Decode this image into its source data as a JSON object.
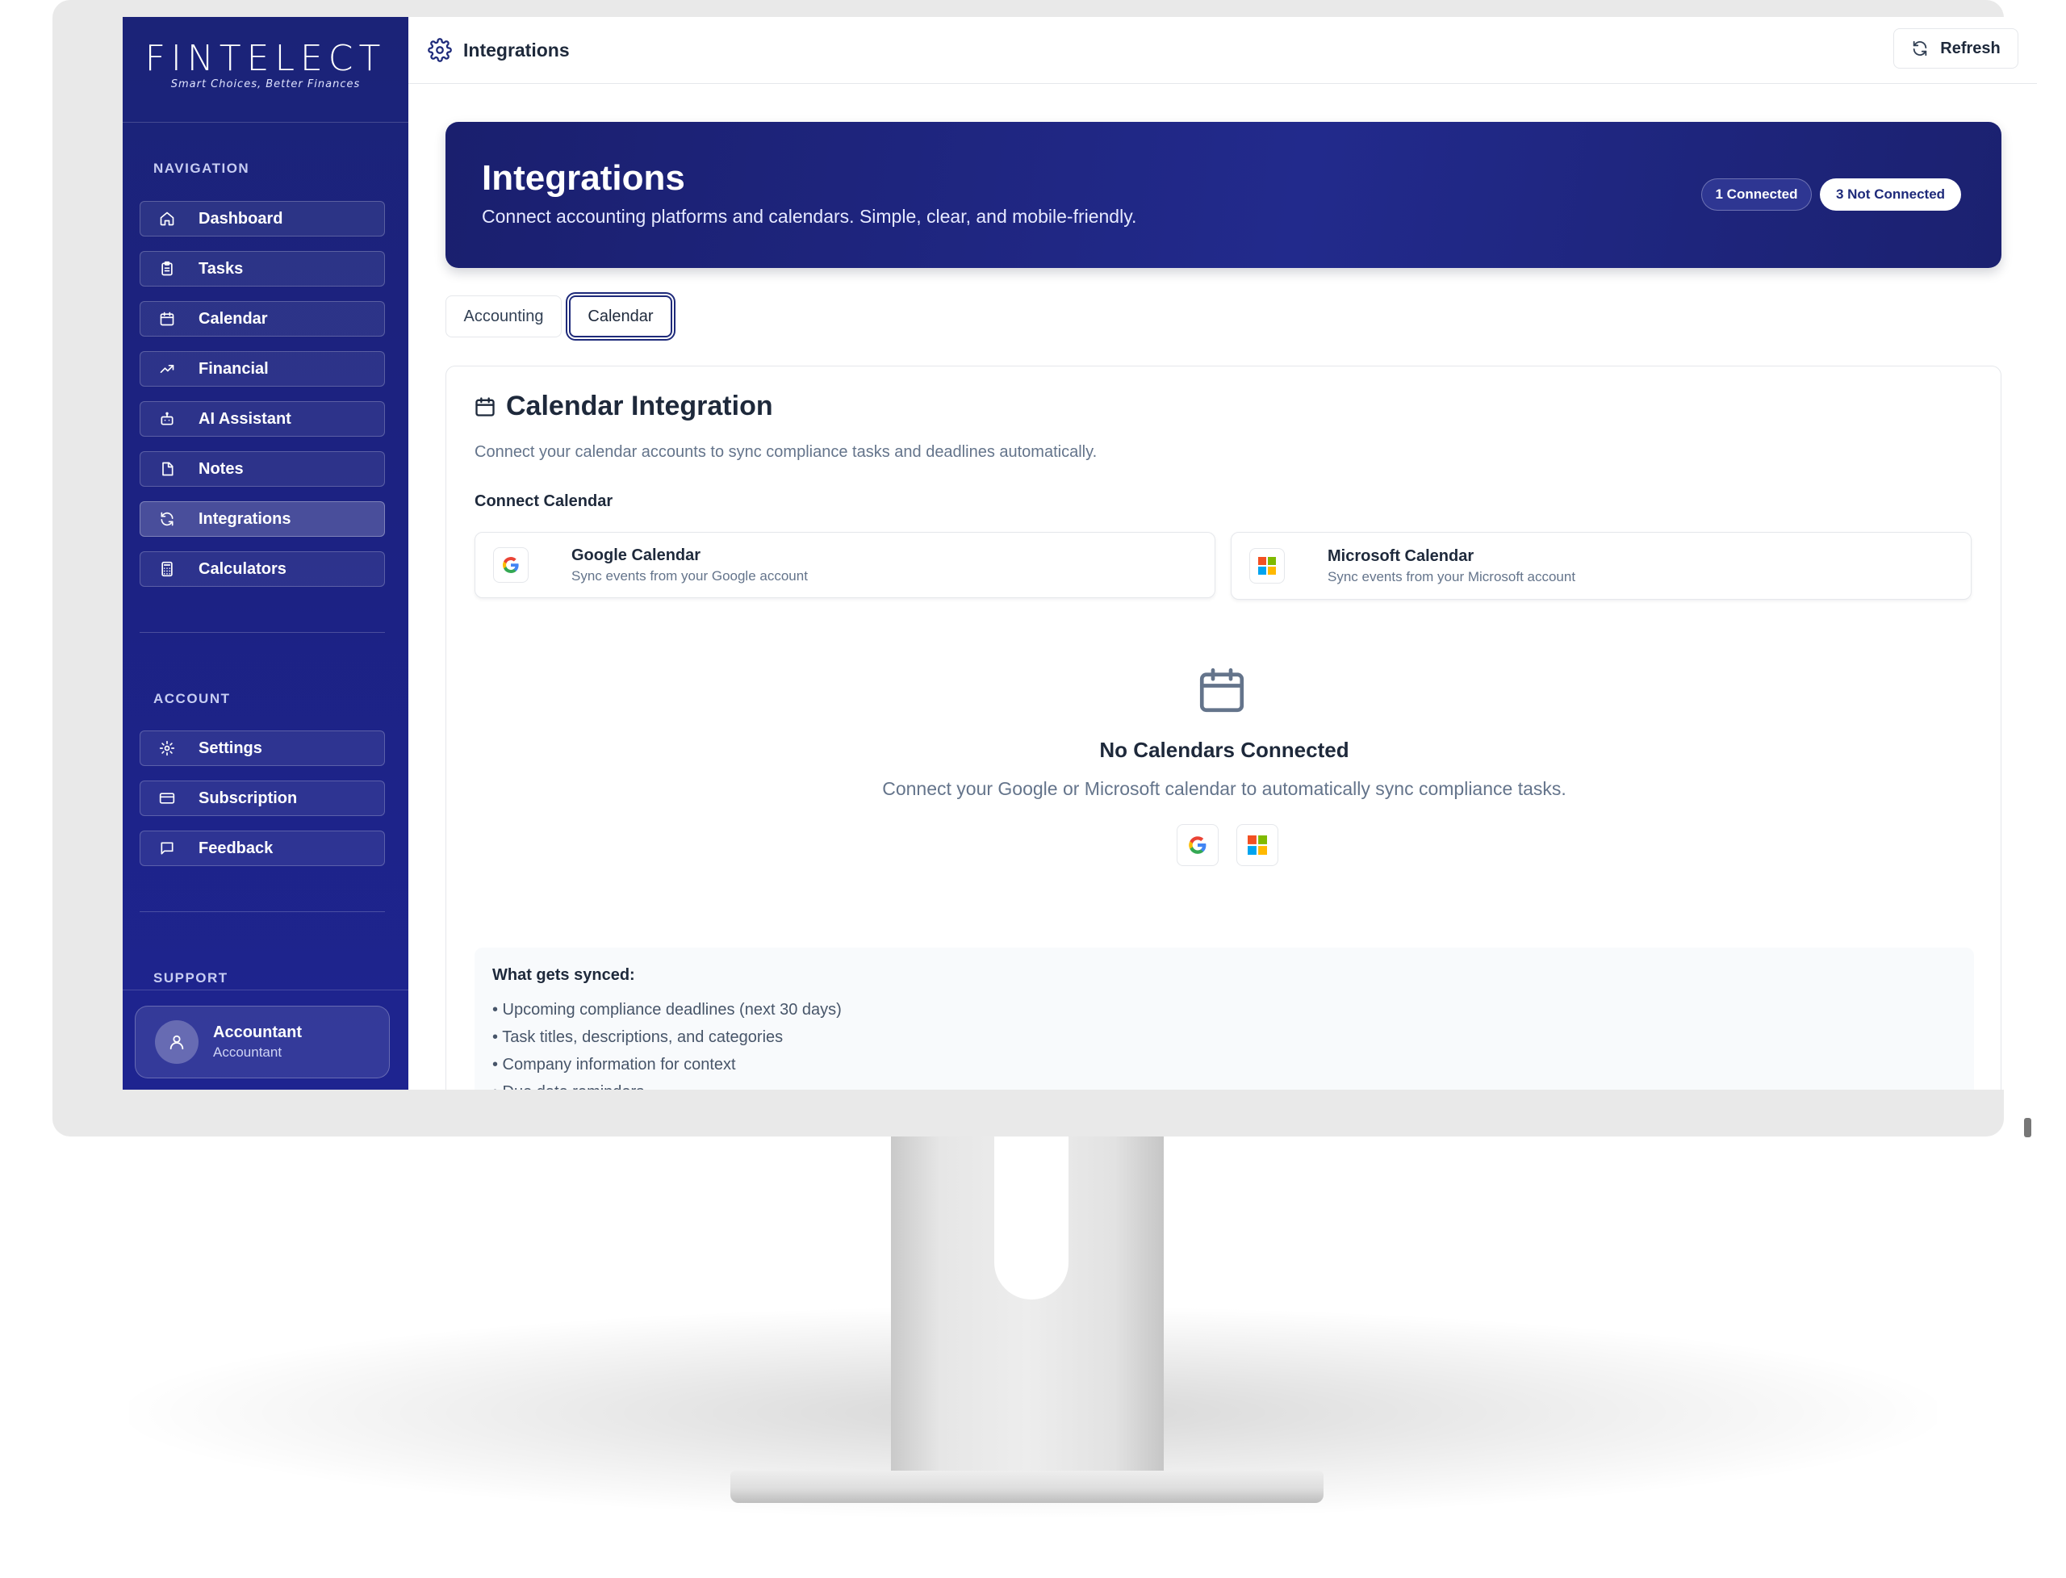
{
  "brand": {
    "name": "FINTELECT",
    "tagline": "Smart Choices, Better Finances"
  },
  "sidebar": {
    "navigation_label": "NAVIGATION",
    "navigation": [
      {
        "label": "Dashboard",
        "icon": "home-icon"
      },
      {
        "label": "Tasks",
        "icon": "clipboard-icon"
      },
      {
        "label": "Calendar",
        "icon": "calendar-icon"
      },
      {
        "label": "Financial",
        "icon": "trending-up-icon"
      },
      {
        "label": "AI Assistant",
        "icon": "bot-icon"
      },
      {
        "label": "Notes",
        "icon": "file-icon"
      },
      {
        "label": "Integrations",
        "icon": "refresh-icon",
        "active": true
      },
      {
        "label": "Calculators",
        "icon": "calculator-icon"
      }
    ],
    "account_label": "ACCOUNT",
    "account": [
      {
        "label": "Settings",
        "icon": "gear-icon"
      },
      {
        "label": "Subscription",
        "icon": "credit-card-icon"
      },
      {
        "label": "Feedback",
        "icon": "message-icon"
      }
    ],
    "support_label": "SUPPORT",
    "user": {
      "name": "Accountant",
      "role": "Accountant"
    }
  },
  "topbar": {
    "title": "Integrations",
    "refresh_label": "Refresh"
  },
  "hero": {
    "title": "Integrations",
    "subtitle": "Connect accounting platforms and calendars. Simple, clear, and mobile-friendly.",
    "connected_badge": "1 Connected",
    "not_connected_badge": "3 Not Connected"
  },
  "tabs": [
    {
      "label": "Accounting",
      "active": false
    },
    {
      "label": "Calendar",
      "active": true
    }
  ],
  "calendar_panel": {
    "title": "Calendar Integration",
    "description": "Connect your calendar accounts to sync compliance tasks and deadlines automatically.",
    "connect_label": "Connect Calendar",
    "providers": [
      {
        "name": "Google Calendar",
        "subtitle": "Sync events from your Google account"
      },
      {
        "name": "Microsoft Calendar",
        "subtitle": "Sync events from your Microsoft account"
      }
    ],
    "empty_title": "No Calendars Connected",
    "empty_subtitle": "Connect your Google or Microsoft calendar to automatically sync compliance tasks.",
    "synced_title": "What gets synced:",
    "synced_items": [
      "• Upcoming compliance deadlines (next 30 days)",
      "• Task titles, descriptions, and categories",
      "• Company information for context",
      "• Due date reminders"
    ]
  },
  "colors": {
    "sidebar": "#1c2282",
    "hero": "#222a8c",
    "accent": "#1e2a7a",
    "google_blue": "#4285F4",
    "google_red": "#EA4335",
    "google_yellow": "#FBBC05",
    "google_green": "#34A853",
    "ms_red": "#F25022",
    "ms_green": "#7FBA00",
    "ms_blue": "#00A4EF",
    "ms_yellow": "#FFB900"
  }
}
